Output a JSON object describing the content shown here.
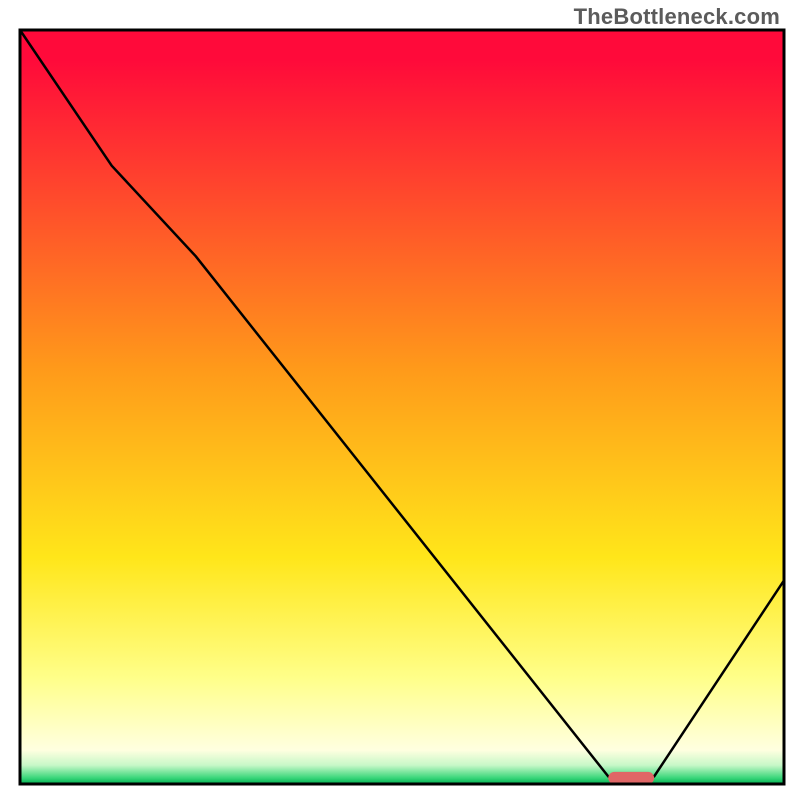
{
  "watermark": "TheBottleneck.com",
  "chart_data": {
    "type": "line",
    "title": "",
    "xlabel": "",
    "ylabel": "",
    "xlim": [
      0,
      100
    ],
    "ylim": [
      0,
      100
    ],
    "background_gradient": {
      "stops": [
        {
          "offset": 0.04,
          "color": "#ff0a3a"
        },
        {
          "offset": 0.45,
          "color": "#ff9a1a"
        },
        {
          "offset": 0.7,
          "color": "#ffe61a"
        },
        {
          "offset": 0.86,
          "color": "#ffff8a"
        },
        {
          "offset": 0.955,
          "color": "#ffffe0"
        },
        {
          "offset": 0.975,
          "color": "#c8f8c8"
        },
        {
          "offset": 0.992,
          "color": "#39d67a"
        },
        {
          "offset": 1.0,
          "color": "#00b050"
        }
      ]
    },
    "series": [
      {
        "name": "bottleneck-curve",
        "color": "#000000",
        "width": 2.5,
        "x": [
          0,
          12,
          23,
          77,
          83,
          100
        ],
        "y": [
          100,
          82,
          70,
          1,
          1,
          27
        ]
      }
    ],
    "marker": {
      "name": "optimal-range",
      "color": "#e06666",
      "x_center": 80,
      "y": 0.8,
      "width": 6,
      "height": 1.6,
      "rx": 0.8
    },
    "axes": {
      "show_ticks": false,
      "show_grid": false,
      "border_color": "#000000",
      "border_width": 3
    }
  }
}
